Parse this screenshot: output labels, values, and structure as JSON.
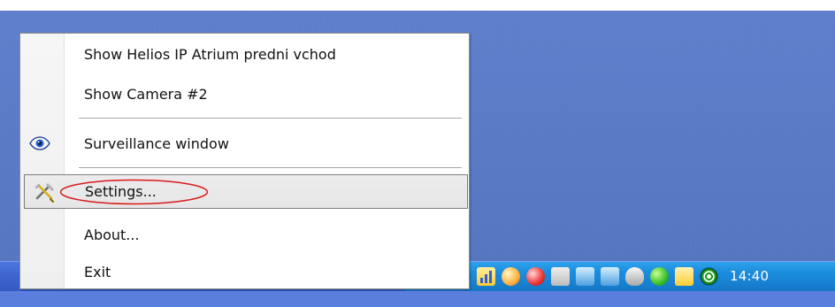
{
  "menu": {
    "items": [
      {
        "label": "Show Helios IP Atrium predni vchod"
      },
      {
        "label": "Show Camera #2"
      },
      {
        "label": "Surveillance window"
      },
      {
        "label": "Settings..."
      },
      {
        "label": "About..."
      },
      {
        "label": "Exit"
      }
    ]
  },
  "tray": {
    "time": "14:40",
    "icons": [
      "tray-box-icon",
      "globe-icon",
      "chart-icon",
      "clock-icon",
      "stop-icon",
      "gray-icon",
      "wireless-icon",
      "network-icon",
      "shield-icon",
      "green-icon",
      "star-icon",
      "target-icon"
    ]
  },
  "colors": {
    "desktop": "#5a7edc",
    "taskbar": "#3f66cf",
    "tray": "#1c8ddd",
    "menu_highlight": "#e6e6e6",
    "annotation_red": "#d71b1b"
  }
}
